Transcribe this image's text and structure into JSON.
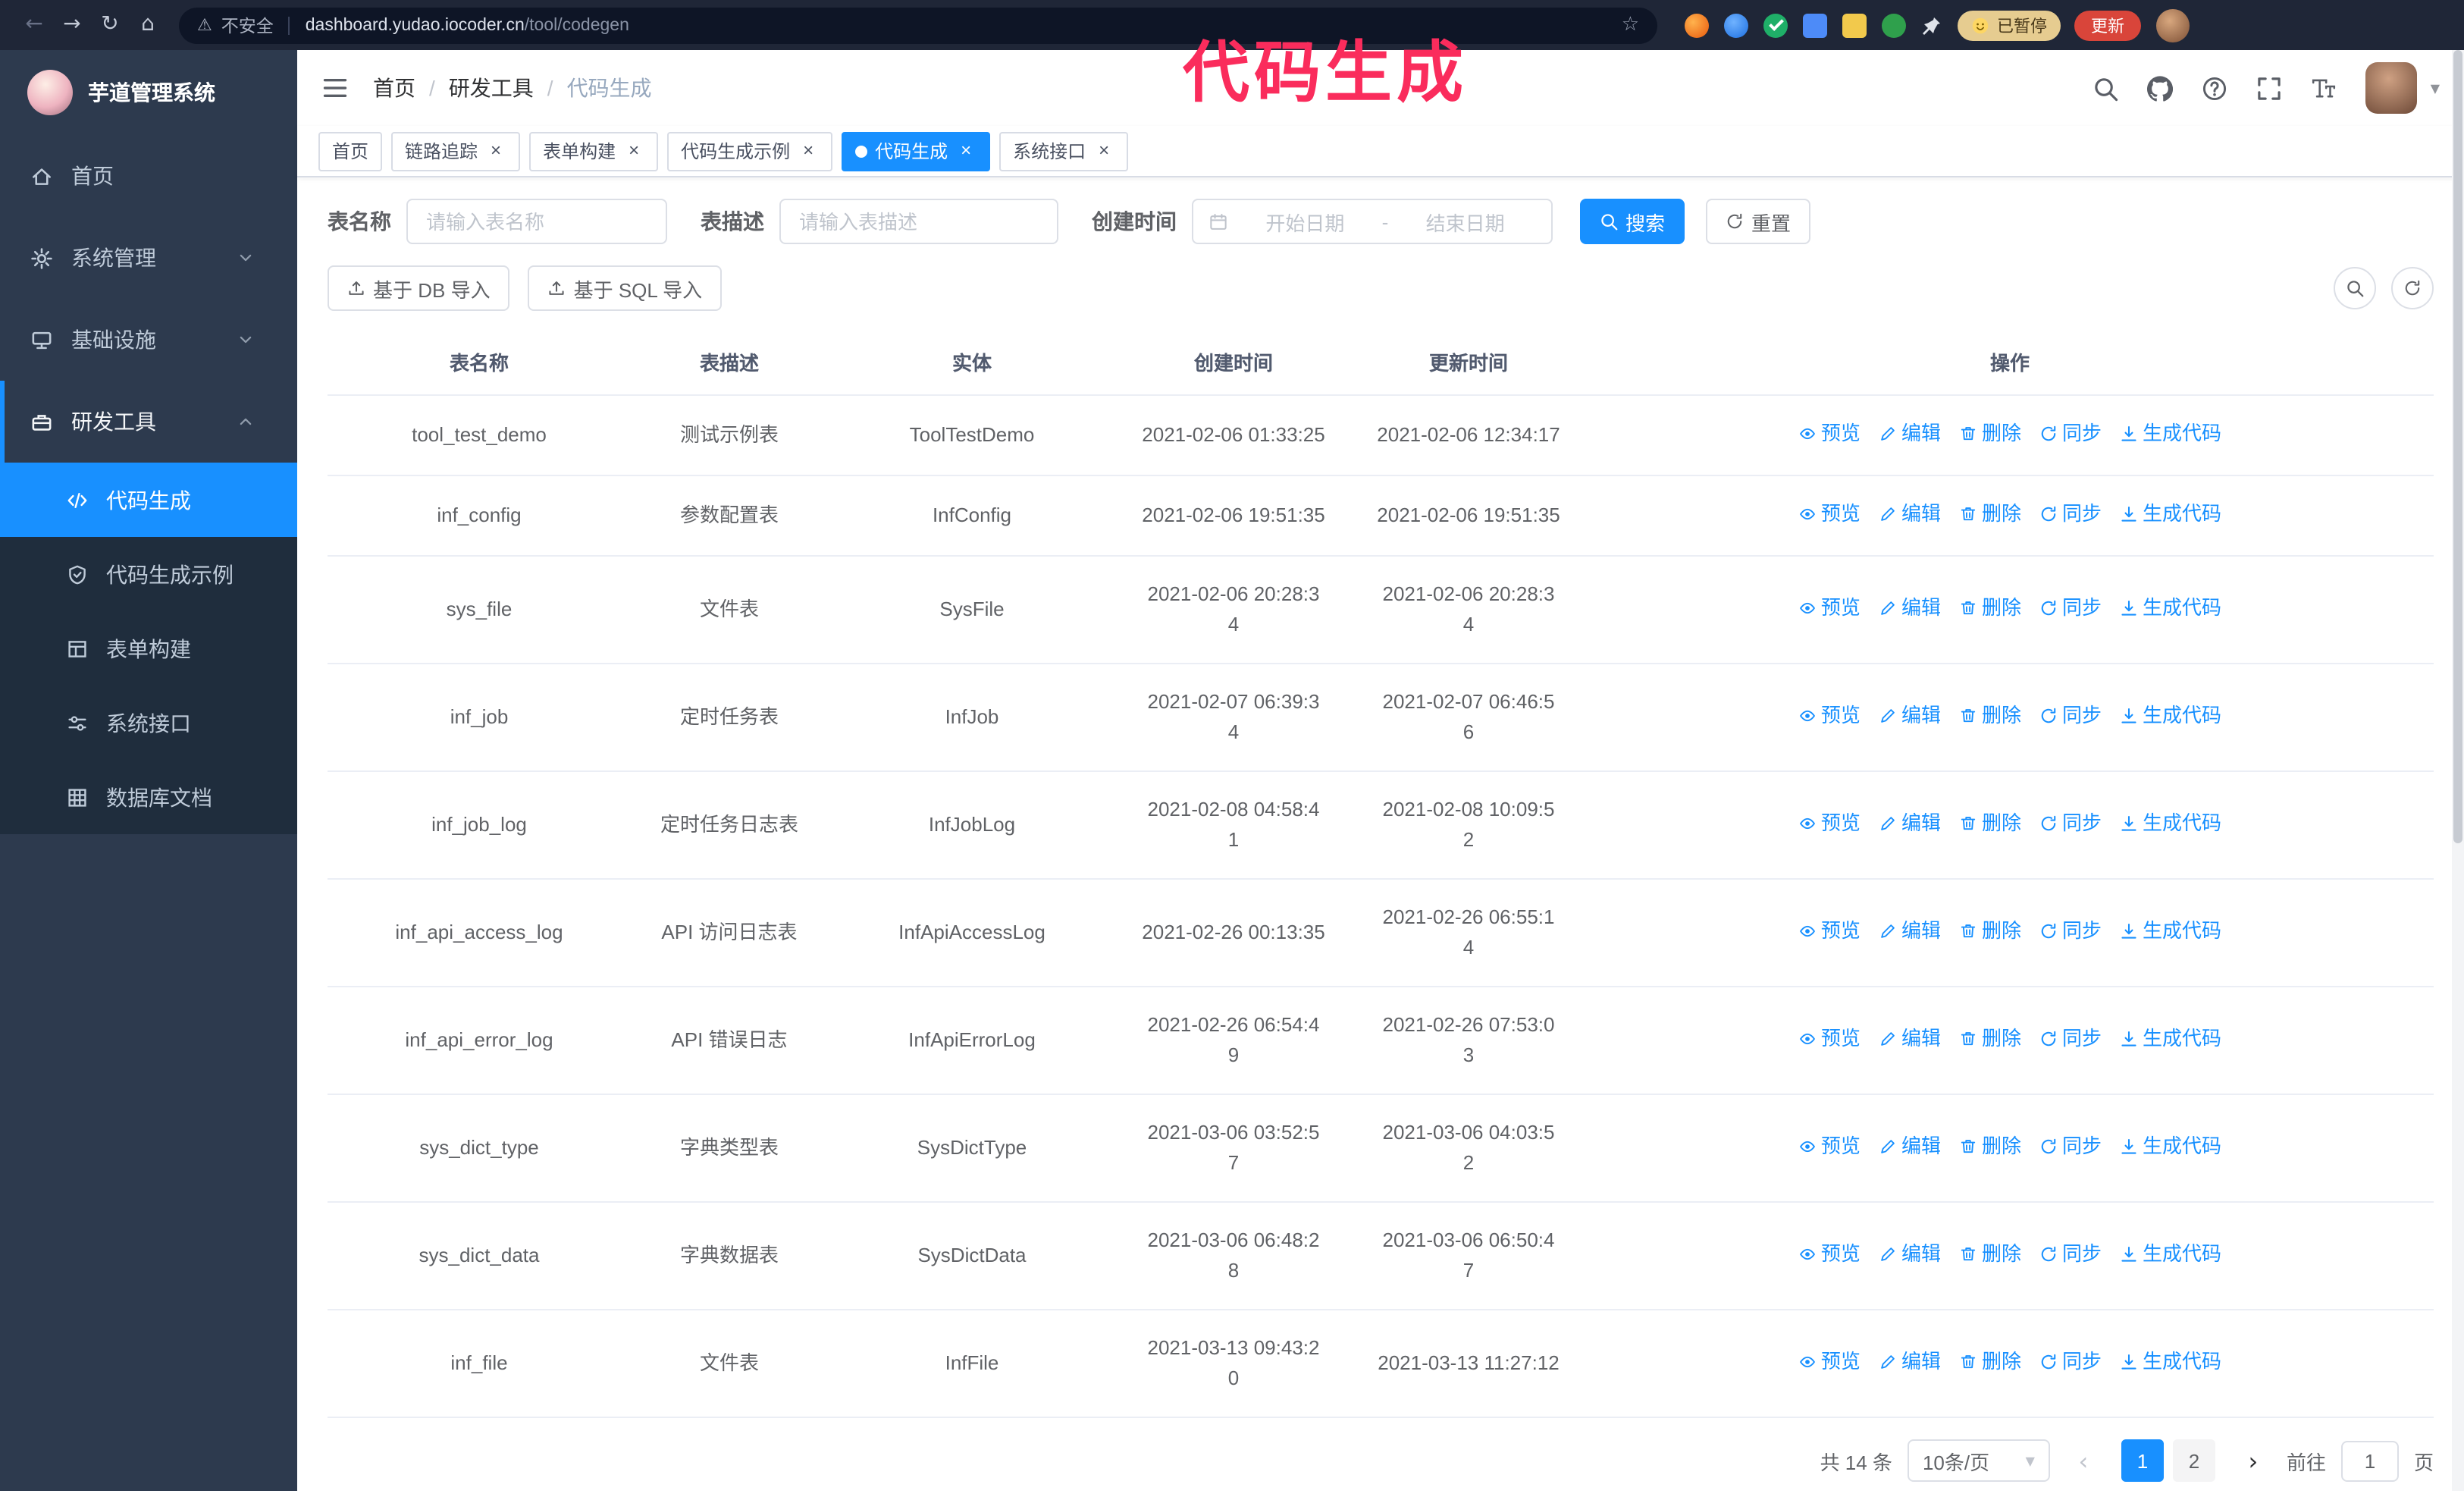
{
  "annotation": {
    "text": "代码生成",
    "color": "#fa2c5c"
  },
  "browser": {
    "back_icon": "←",
    "forward_icon": "→",
    "reload_icon": "↻",
    "home_icon": "⌂",
    "warning_icon": "⚠",
    "security_label": "不安全",
    "url_domain": "dashboard.yudao.iocoder.cn",
    "url_path": "/tool/codegen",
    "star_icon": "☆",
    "paused_badge": "已暂停",
    "update_button": "更新"
  },
  "sidebar": {
    "title": "芋道管理系统",
    "menu": [
      {
        "key": "home",
        "label": "首页",
        "icon": "home"
      },
      {
        "key": "system",
        "label": "系统管理",
        "icon": "gear",
        "chevron": "down"
      },
      {
        "key": "infra",
        "label": "基础设施",
        "icon": "infra",
        "chevron": "down"
      },
      {
        "key": "devtools",
        "label": "研发工具",
        "icon": "tools",
        "chevron": "up",
        "expanded": true
      }
    ],
    "submenu": [
      {
        "key": "codegen",
        "label": "代码生成",
        "icon": "code",
        "active": true
      },
      {
        "key": "codegen-example",
        "label": "代码生成示例",
        "icon": "example"
      },
      {
        "key": "form-builder",
        "label": "表单构建",
        "icon": "form"
      },
      {
        "key": "system-api",
        "label": "系统接口",
        "icon": "api"
      },
      {
        "key": "db-doc",
        "label": "数据库文档",
        "icon": "db"
      }
    ]
  },
  "header": {
    "breadcrumb": [
      "首页",
      "研发工具",
      "代码生成"
    ],
    "separator": "/",
    "caret_icon": "▼"
  },
  "tags": {
    "close_icon": "×",
    "items": [
      {
        "label": "首页",
        "closable": false,
        "active": false
      },
      {
        "label": "链路追踪",
        "closable": true,
        "active": false
      },
      {
        "label": "表单构建",
        "closable": true,
        "active": false
      },
      {
        "label": "代码生成示例",
        "closable": true,
        "active": false
      },
      {
        "label": "代码生成",
        "closable": true,
        "active": true
      },
      {
        "label": "系统接口",
        "closable": true,
        "active": false
      }
    ]
  },
  "filters": {
    "name_label": "表名称",
    "name_placeholder": "请输入表名称",
    "desc_label": "表描述",
    "desc_placeholder": "请输入表描述",
    "time_label": "创建时间",
    "start_placeholder": "开始日期",
    "range_separator": "-",
    "end_placeholder": "结束日期",
    "search_button": "搜索",
    "reset_button": "重置"
  },
  "toolbar": {
    "import_db": "基于 DB 导入",
    "import_sql": "基于 SQL 导入"
  },
  "table": {
    "columns": [
      "表名称",
      "表描述",
      "实体",
      "创建时间",
      "更新时间",
      "操作"
    ],
    "actions": [
      {
        "key": "preview",
        "label": "预览",
        "icon": "eye"
      },
      {
        "key": "edit",
        "label": "编辑",
        "icon": "edit"
      },
      {
        "key": "delete",
        "label": "删除",
        "icon": "trash"
      },
      {
        "key": "sync",
        "label": "同步",
        "icon": "sync"
      },
      {
        "key": "generate",
        "label": "生成代码",
        "icon": "download"
      }
    ],
    "rows": [
      {
        "name": "tool_test_demo",
        "desc": "测试示例表",
        "entity": "ToolTestDemo",
        "created": "2021-02-06 01:33:25",
        "updated": "2021-02-06 12:34:17"
      },
      {
        "name": "inf_config",
        "desc": "参数配置表",
        "entity": "InfConfig",
        "created": "2021-02-06 19:51:35",
        "updated": "2021-02-06 19:51:35"
      },
      {
        "name": "sys_file",
        "desc": "文件表",
        "entity": "SysFile",
        "created": "2021-02-06 20:28:3\n4",
        "updated": "2021-02-06 20:28:3\n4"
      },
      {
        "name": "inf_job",
        "desc": "定时任务表",
        "entity": "InfJob",
        "created": "2021-02-07 06:39:3\n4",
        "updated": "2021-02-07 06:46:5\n6"
      },
      {
        "name": "inf_job_log",
        "desc": "定时任务日志表",
        "entity": "InfJobLog",
        "created": "2021-02-08 04:58:4\n1",
        "updated": "2021-02-08 10:09:5\n2"
      },
      {
        "name": "inf_api_access_log",
        "desc": "API 访问日志表",
        "entity": "InfApiAccessLog",
        "created": "2021-02-26 00:13:35",
        "updated": "2021-02-26 06:55:1\n4"
      },
      {
        "name": "inf_api_error_log",
        "desc": "API 错误日志",
        "entity": "InfApiErrorLog",
        "created": "2021-02-26 06:54:4\n9",
        "updated": "2021-02-26 07:53:0\n3"
      },
      {
        "name": "sys_dict_type",
        "desc": "字典类型表",
        "entity": "SysDictType",
        "created": "2021-03-06 03:52:5\n7",
        "updated": "2021-03-06 04:03:5\n2"
      },
      {
        "name": "sys_dict_data",
        "desc": "字典数据表",
        "entity": "SysDictData",
        "created": "2021-03-06 06:48:2\n8",
        "updated": "2021-03-06 06:50:4\n7"
      },
      {
        "name": "inf_file",
        "desc": "文件表",
        "entity": "InfFile",
        "created": "2021-03-13 09:43:2\n0",
        "updated": "2021-03-13 11:27:12"
      }
    ]
  },
  "pagination": {
    "total": "共 14 条",
    "page_size": "10条/页",
    "caret_icon": "▼",
    "prev_icon": "‹",
    "next_icon": "›",
    "pages": [
      {
        "label": "1",
        "active": true
      },
      {
        "label": "2",
        "active": false
      }
    ],
    "goto_label": "前往",
    "goto_value": "1",
    "goto_unit": "页"
  }
}
